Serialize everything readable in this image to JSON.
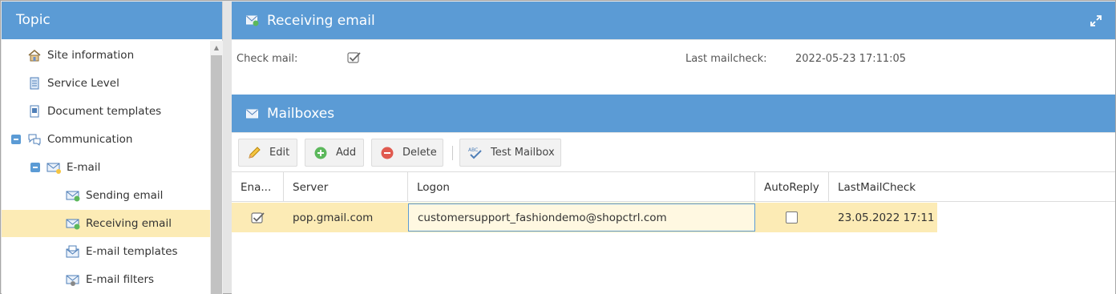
{
  "left_panel": {
    "title": "Topic",
    "tree": [
      {
        "label": "Site information",
        "icon": "house-icon"
      },
      {
        "label": "Service Level",
        "icon": "scroll-icon"
      },
      {
        "label": "Document templates",
        "icon": "document-icon"
      },
      {
        "label": "Communication",
        "icon": "speech-bubbles-icon",
        "expanded": true
      },
      {
        "label": "E-mail",
        "icon": "envelope-icon",
        "expanded": true
      },
      {
        "label": "Sending email",
        "icon": "envelope-send-icon"
      },
      {
        "label": "Receiving email",
        "icon": "envelope-receive-icon",
        "selected": true
      },
      {
        "label": "E-mail templates",
        "icon": "envelope-template-icon"
      },
      {
        "label": "E-mail filters",
        "icon": "envelope-filter-icon"
      }
    ]
  },
  "receiving": {
    "title": "Receiving email",
    "check_mail_label": "Check mail:",
    "check_mail_checked": true,
    "last_check_label": "Last mailcheck:",
    "last_check_value": "2022-05-23 17:11:05"
  },
  "mailboxes": {
    "title": "Mailboxes",
    "toolbar": {
      "edit": "Edit",
      "add": "Add",
      "delete": "Delete",
      "test": "Test Mailbox"
    },
    "columns": [
      "Ena...",
      "Server",
      "Logon",
      "AutoReply",
      "LastMailCheck"
    ],
    "rows": [
      {
        "enabled": true,
        "server": "pop.gmail.com",
        "logon": "customersupport_fashiondemo@shopctrl.com",
        "autoreply": false,
        "last_mail_check": "23.05.2022 17:11"
      }
    ]
  },
  "colors": {
    "header_blue": "#5b9bd5",
    "selection_yellow": "#fcebb5"
  }
}
